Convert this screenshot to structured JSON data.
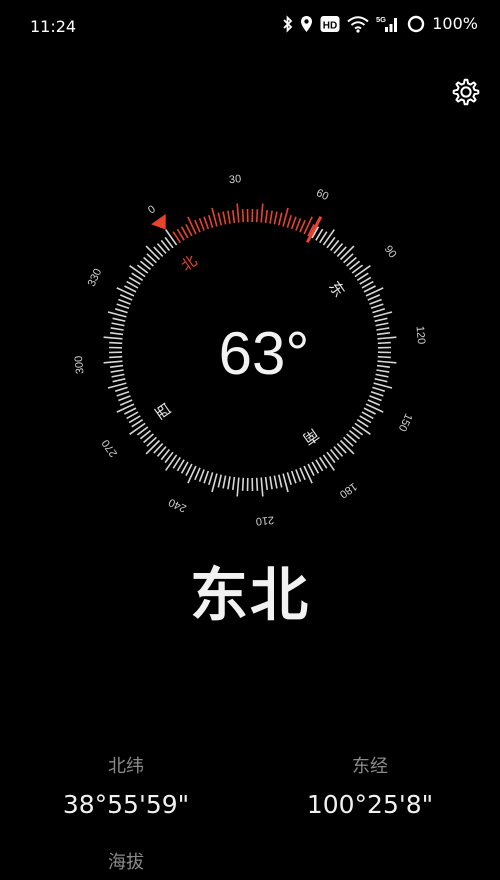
{
  "status_bar": {
    "time": "11:24",
    "icons": [
      "bluetooth-icon",
      "location-icon",
      "hd-icon",
      "wifi-icon",
      "5g-signal-icon",
      "battery-icon"
    ],
    "hd_label": "HD",
    "network_label": "5G",
    "battery": "100%"
  },
  "settings_icon": "gear-icon",
  "compass": {
    "heading_display": "63°",
    "heading_degrees": 63,
    "degree_labels": [
      "0",
      "30",
      "60",
      "90",
      "120",
      "150",
      "180",
      "210",
      "240",
      "270",
      "300",
      "330"
    ],
    "cardinals": {
      "north": "北",
      "east": "东",
      "south": "南",
      "west": "西"
    },
    "accent_color": "#e8432e"
  },
  "direction": "东北",
  "coordinates": {
    "latitude_label": "北纬",
    "latitude_value": "38°55'59\"",
    "longitude_label": "东经",
    "longitude_value": "100°25'8\"",
    "altitude_label": "海拔"
  }
}
